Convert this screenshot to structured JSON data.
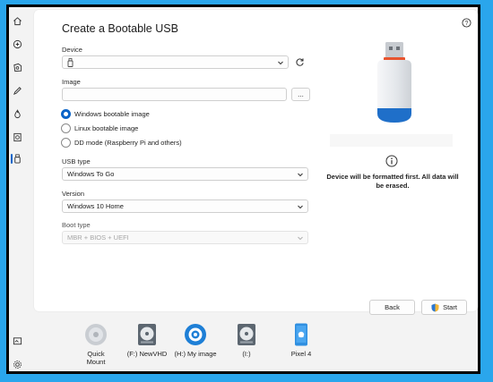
{
  "app": {
    "title": "Create a Bootable USB"
  },
  "device": {
    "label": "Device",
    "value": ""
  },
  "image": {
    "label": "Image",
    "value": "",
    "browse_label": "..."
  },
  "image_modes": [
    {
      "label": "Windows bootable image",
      "checked": true
    },
    {
      "label": "Linux bootable image",
      "checked": false
    },
    {
      "label": "DD mode (Raspberry Pi and others)",
      "checked": false
    }
  ],
  "usb_type": {
    "label": "USB type",
    "value": "Windows To Go"
  },
  "version": {
    "label": "Version",
    "value": "Windows 10 Home"
  },
  "boot_type": {
    "label": "Boot type",
    "value": "MBR + BIOS + UEFI"
  },
  "info": {
    "warning": "Device will be formatted first. All data will be erased."
  },
  "buttons": {
    "back": "Back",
    "start": "Start"
  },
  "taskbar": {
    "drives": [
      {
        "label": "Quick\nMount",
        "icon": "disc-icon"
      },
      {
        "label": "(F:) NewVHD",
        "icon": "hard-drive-icon"
      },
      {
        "label": "(H:) My image",
        "icon": "disc-image-icon"
      },
      {
        "label": "(I:)",
        "icon": "hard-drive-icon"
      },
      {
        "label": "Pixel 4",
        "icon": "android-phone-icon"
      }
    ]
  },
  "colors": {
    "accent": "#0a64c8",
    "background": "#2aa6ec",
    "usb_cap": "#e8542f"
  }
}
